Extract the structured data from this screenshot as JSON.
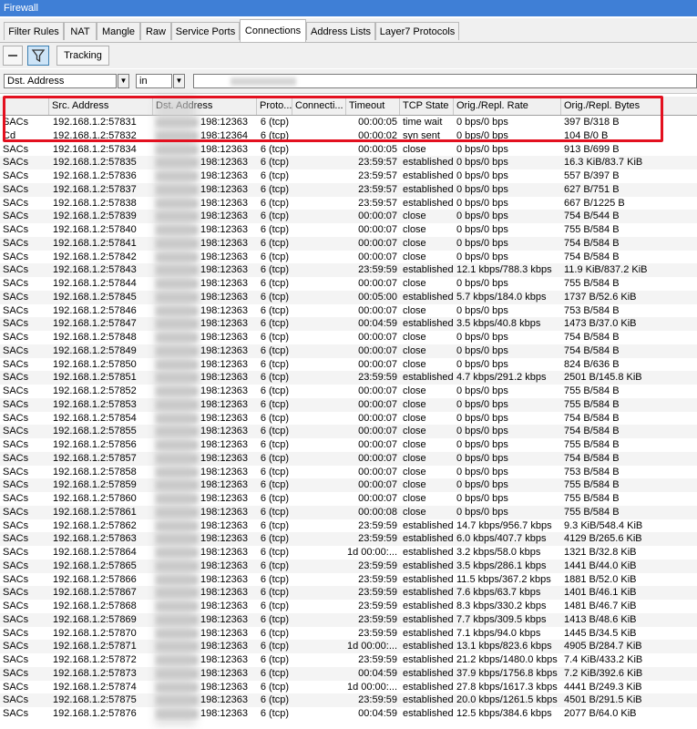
{
  "window": {
    "title": "Firewall"
  },
  "tabs": [
    "Filter Rules",
    "NAT",
    "Mangle",
    "Raw",
    "Service Ports",
    "Connections",
    "Address Lists",
    "Layer7 Protocols"
  ],
  "toolbar": {
    "remove_icon": "minus-icon",
    "filter_icon": "funnel-icon",
    "tracking_label": "Tracking"
  },
  "filter": {
    "field": "Dst. Address",
    "operator": "in"
  },
  "columns": [
    "",
    "Src. Address",
    "Dst. Address",
    "Proto...",
    "Connecti...",
    "Timeout",
    "TCP State",
    "Orig./Repl. Rate",
    "Orig./Repl. Bytes"
  ],
  "highlight_color": "#e3101f",
  "rows": [
    {
      "flags": "SACs",
      "src": "192.168.1.2:57831",
      "dst_tail": "198:12363",
      "proto": "6 (tcp)",
      "timeout": "00:00:05",
      "state": "time wait",
      "rate": "0 bps/0 bps",
      "bytes": "397 B/318 B"
    },
    {
      "flags": "Cd",
      "src": "192.168.1.2:57832",
      "dst_tail": "198:12364",
      "proto": "6 (tcp)",
      "timeout": "00:00:02",
      "state": "syn sent",
      "rate": "0 bps/0 bps",
      "bytes": "104 B/0 B"
    },
    {
      "flags": "SACs",
      "src": "192.168.1.2:57834",
      "dst_tail": "198:12363",
      "proto": "6 (tcp)",
      "timeout": "00:00:05",
      "state": "close",
      "rate": "0 bps/0 bps",
      "bytes": "913 B/699 B"
    },
    {
      "flags": "SACs",
      "src": "192.168.1.2:57835",
      "dst_tail": "198:12363",
      "proto": "6 (tcp)",
      "timeout": "23:59:57",
      "state": "established",
      "rate": "0 bps/0 bps",
      "bytes": "16.3 KiB/83.7 KiB"
    },
    {
      "flags": "SACs",
      "src": "192.168.1.2:57836",
      "dst_tail": "198:12363",
      "proto": "6 (tcp)",
      "timeout": "23:59:57",
      "state": "established",
      "rate": "0 bps/0 bps",
      "bytes": "557 B/397 B"
    },
    {
      "flags": "SACs",
      "src": "192.168.1.2:57837",
      "dst_tail": "198:12363",
      "proto": "6 (tcp)",
      "timeout": "23:59:57",
      "state": "established",
      "rate": "0 bps/0 bps",
      "bytes": "627 B/751 B"
    },
    {
      "flags": "SACs",
      "src": "192.168.1.2:57838",
      "dst_tail": "198:12363",
      "proto": "6 (tcp)",
      "timeout": "23:59:57",
      "state": "established",
      "rate": "0 bps/0 bps",
      "bytes": "667 B/1225 B"
    },
    {
      "flags": "SACs",
      "src": "192.168.1.2:57839",
      "dst_tail": "198:12363",
      "proto": "6 (tcp)",
      "timeout": "00:00:07",
      "state": "close",
      "rate": "0 bps/0 bps",
      "bytes": "754 B/544 B"
    },
    {
      "flags": "SACs",
      "src": "192.168.1.2:57840",
      "dst_tail": "198:12363",
      "proto": "6 (tcp)",
      "timeout": "00:00:07",
      "state": "close",
      "rate": "0 bps/0 bps",
      "bytes": "755 B/584 B"
    },
    {
      "flags": "SACs",
      "src": "192.168.1.2:57841",
      "dst_tail": "198:12363",
      "proto": "6 (tcp)",
      "timeout": "00:00:07",
      "state": "close",
      "rate": "0 bps/0 bps",
      "bytes": "754 B/584 B"
    },
    {
      "flags": "SACs",
      "src": "192.168.1.2:57842",
      "dst_tail": "198:12363",
      "proto": "6 (tcp)",
      "timeout": "00:00:07",
      "state": "close",
      "rate": "0 bps/0 bps",
      "bytes": "754 B/584 B"
    },
    {
      "flags": "SACs",
      "src": "192.168.1.2:57843",
      "dst_tail": "198:12363",
      "proto": "6 (tcp)",
      "timeout": "23:59:59",
      "state": "established",
      "rate": "12.1 kbps/788.3 kbps",
      "bytes": "11.9 KiB/837.2 KiB"
    },
    {
      "flags": "SACs",
      "src": "192.168.1.2:57844",
      "dst_tail": "198:12363",
      "proto": "6 (tcp)",
      "timeout": "00:00:07",
      "state": "close",
      "rate": "0 bps/0 bps",
      "bytes": "755 B/584 B"
    },
    {
      "flags": "SACs",
      "src": "192.168.1.2:57845",
      "dst_tail": "198:12363",
      "proto": "6 (tcp)",
      "timeout": "00:05:00",
      "state": "established",
      "rate": "5.7 kbps/184.0 kbps",
      "bytes": "1737 B/52.6 KiB"
    },
    {
      "flags": "SACs",
      "src": "192.168.1.2:57846",
      "dst_tail": "198:12363",
      "proto": "6 (tcp)",
      "timeout": "00:00:07",
      "state": "close",
      "rate": "0 bps/0 bps",
      "bytes": "753 B/584 B"
    },
    {
      "flags": "SACs",
      "src": "192.168.1.2:57847",
      "dst_tail": "198:12363",
      "proto": "6 (tcp)",
      "timeout": "00:04:59",
      "state": "established",
      "rate": "3.5 kbps/40.8 kbps",
      "bytes": "1473 B/37.0 KiB"
    },
    {
      "flags": "SACs",
      "src": "192.168.1.2:57848",
      "dst_tail": "198:12363",
      "proto": "6 (tcp)",
      "timeout": "00:00:07",
      "state": "close",
      "rate": "0 bps/0 bps",
      "bytes": "754 B/584 B"
    },
    {
      "flags": "SACs",
      "src": "192.168.1.2:57849",
      "dst_tail": "198:12363",
      "proto": "6 (tcp)",
      "timeout": "00:00:07",
      "state": "close",
      "rate": "0 bps/0 bps",
      "bytes": "754 B/584 B"
    },
    {
      "flags": "SACs",
      "src": "192.168.1.2:57850",
      "dst_tail": "198:12363",
      "proto": "6 (tcp)",
      "timeout": "00:00:07",
      "state": "close",
      "rate": "0 bps/0 bps",
      "bytes": "824 B/636 B"
    },
    {
      "flags": "SACs",
      "src": "192.168.1.2:57851",
      "dst_tail": "198:12363",
      "proto": "6 (tcp)",
      "timeout": "23:59:59",
      "state": "established",
      "rate": "4.7 kbps/291.2 kbps",
      "bytes": "2501 B/145.8 KiB"
    },
    {
      "flags": "SACs",
      "src": "192.168.1.2:57852",
      "dst_tail": "198:12363",
      "proto": "6 (tcp)",
      "timeout": "00:00:07",
      "state": "close",
      "rate": "0 bps/0 bps",
      "bytes": "755 B/584 B"
    },
    {
      "flags": "SACs",
      "src": "192.168.1.2:57853",
      "dst_tail": "198:12363",
      "proto": "6 (tcp)",
      "timeout": "00:00:07",
      "state": "close",
      "rate": "0 bps/0 bps",
      "bytes": "755 B/584 B"
    },
    {
      "flags": "SACs",
      "src": "192.168.1.2:57854",
      "dst_tail": "198:12363",
      "proto": "6 (tcp)",
      "timeout": "00:00:07",
      "state": "close",
      "rate": "0 bps/0 bps",
      "bytes": "754 B/584 B"
    },
    {
      "flags": "SACs",
      "src": "192.168.1.2:57855",
      "dst_tail": "198:12363",
      "proto": "6 (tcp)",
      "timeout": "00:00:07",
      "state": "close",
      "rate": "0 bps/0 bps",
      "bytes": "754 B/584 B"
    },
    {
      "flags": "SACs",
      "src": "192.168.1.2:57856",
      "dst_tail": "198:12363",
      "proto": "6 (tcp)",
      "timeout": "00:00:07",
      "state": "close",
      "rate": "0 bps/0 bps",
      "bytes": "755 B/584 B"
    },
    {
      "flags": "SACs",
      "src": "192.168.1.2:57857",
      "dst_tail": "198:12363",
      "proto": "6 (tcp)",
      "timeout": "00:00:07",
      "state": "close",
      "rate": "0 bps/0 bps",
      "bytes": "754 B/584 B"
    },
    {
      "flags": "SACs",
      "src": "192.168.1.2:57858",
      "dst_tail": "198:12363",
      "proto": "6 (tcp)",
      "timeout": "00:00:07",
      "state": "close",
      "rate": "0 bps/0 bps",
      "bytes": "753 B/584 B"
    },
    {
      "flags": "SACs",
      "src": "192.168.1.2:57859",
      "dst_tail": "198:12363",
      "proto": "6 (tcp)",
      "timeout": "00:00:07",
      "state": "close",
      "rate": "0 bps/0 bps",
      "bytes": "755 B/584 B"
    },
    {
      "flags": "SACs",
      "src": "192.168.1.2:57860",
      "dst_tail": "198:12363",
      "proto": "6 (tcp)",
      "timeout": "00:00:07",
      "state": "close",
      "rate": "0 bps/0 bps",
      "bytes": "755 B/584 B"
    },
    {
      "flags": "SACs",
      "src": "192.168.1.2:57861",
      "dst_tail": "198:12363",
      "proto": "6 (tcp)",
      "timeout": "00:00:08",
      "state": "close",
      "rate": "0 bps/0 bps",
      "bytes": "755 B/584 B"
    },
    {
      "flags": "SACs",
      "src": "192.168.1.2:57862",
      "dst_tail": "198:12363",
      "proto": "6 (tcp)",
      "timeout": "23:59:59",
      "state": "established",
      "rate": "14.7 kbps/956.7 kbps",
      "bytes": "9.3 KiB/548.4 KiB"
    },
    {
      "flags": "SACs",
      "src": "192.168.1.2:57863",
      "dst_tail": "198:12363",
      "proto": "6 (tcp)",
      "timeout": "23:59:59",
      "state": "established",
      "rate": "6.0 kbps/407.7 kbps",
      "bytes": "4129 B/265.6 KiB"
    },
    {
      "flags": "SACs",
      "src": "192.168.1.2:57864",
      "dst_tail": "198:12363",
      "proto": "6 (tcp)",
      "timeout": "1d 00:00:...",
      "state": "established",
      "rate": "3.2 kbps/58.0 kbps",
      "bytes": "1321 B/32.8 KiB"
    },
    {
      "flags": "SACs",
      "src": "192.168.1.2:57865",
      "dst_tail": "198:12363",
      "proto": "6 (tcp)",
      "timeout": "23:59:59",
      "state": "established",
      "rate": "3.5 kbps/286.1 kbps",
      "bytes": "1441 B/44.0 KiB"
    },
    {
      "flags": "SACs",
      "src": "192.168.1.2:57866",
      "dst_tail": "198:12363",
      "proto": "6 (tcp)",
      "timeout": "23:59:59",
      "state": "established",
      "rate": "11.5 kbps/367.2 kbps",
      "bytes": "1881 B/52.0 KiB"
    },
    {
      "flags": "SACs",
      "src": "192.168.1.2:57867",
      "dst_tail": "198:12363",
      "proto": "6 (tcp)",
      "timeout": "23:59:59",
      "state": "established",
      "rate": "7.6 kbps/63.7 kbps",
      "bytes": "1401 B/46.1 KiB"
    },
    {
      "flags": "SACs",
      "src": "192.168.1.2:57868",
      "dst_tail": "198:12363",
      "proto": "6 (tcp)",
      "timeout": "23:59:59",
      "state": "established",
      "rate": "8.3 kbps/330.2 kbps",
      "bytes": "1481 B/46.7 KiB"
    },
    {
      "flags": "SACs",
      "src": "192.168.1.2:57869",
      "dst_tail": "198:12363",
      "proto": "6 (tcp)",
      "timeout": "23:59:59",
      "state": "established",
      "rate": "7.7 kbps/309.5 kbps",
      "bytes": "1413 B/48.6 KiB"
    },
    {
      "flags": "SACs",
      "src": "192.168.1.2:57870",
      "dst_tail": "198:12363",
      "proto": "6 (tcp)",
      "timeout": "23:59:59",
      "state": "established",
      "rate": "7.1 kbps/94.0 kbps",
      "bytes": "1445 B/34.5 KiB"
    },
    {
      "flags": "SACs",
      "src": "192.168.1.2:57871",
      "dst_tail": "198:12363",
      "proto": "6 (tcp)",
      "timeout": "1d 00:00:...",
      "state": "established",
      "rate": "13.1 kbps/823.6 kbps",
      "bytes": "4905 B/284.7 KiB"
    },
    {
      "flags": "SACs",
      "src": "192.168.1.2:57872",
      "dst_tail": "198:12363",
      "proto": "6 (tcp)",
      "timeout": "23:59:59",
      "state": "established",
      "rate": "21.2 kbps/1480.0 kbps",
      "bytes": "7.4 KiB/433.2 KiB"
    },
    {
      "flags": "SACs",
      "src": "192.168.1.2:57873",
      "dst_tail": "198:12363",
      "proto": "6 (tcp)",
      "timeout": "00:04:59",
      "state": "established",
      "rate": "37.9 kbps/1756.8 kbps",
      "bytes": "7.2 KiB/392.6 KiB"
    },
    {
      "flags": "SACs",
      "src": "192.168.1.2:57874",
      "dst_tail": "198:12363",
      "proto": "6 (tcp)",
      "timeout": "1d 00:00:...",
      "state": "established",
      "rate": "27.8 kbps/1617.3 kbps",
      "bytes": "4441 B/249.3 KiB"
    },
    {
      "flags": "SACs",
      "src": "192.168.1.2:57875",
      "dst_tail": "198:12363",
      "proto": "6 (tcp)",
      "timeout": "23:59:59",
      "state": "established",
      "rate": "20.0 kbps/1261.5 kbps",
      "bytes": "4501 B/291.5 KiB"
    },
    {
      "flags": "SACs",
      "src": "192.168.1.2:57876",
      "dst_tail": "198:12363",
      "proto": "6 (tcp)",
      "timeout": "00:04:59",
      "state": "established",
      "rate": "12.5 kbps/384.6 kbps",
      "bytes": "2077 B/64.0 KiB"
    }
  ]
}
